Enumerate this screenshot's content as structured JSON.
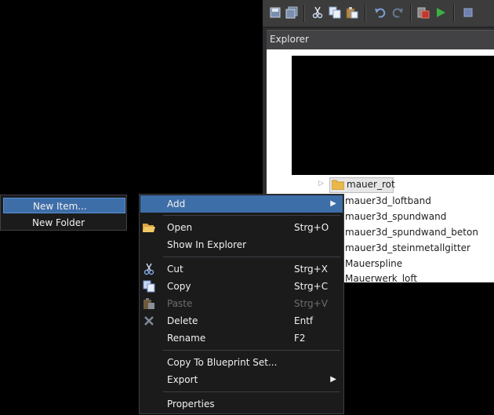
{
  "explorer": {
    "title": "Explorer",
    "tree": {
      "selected_item": "mauer_rot",
      "items": [
        "mauer3d_loftband",
        "mauer3d_spundwand",
        "mauer3d_spundwand_beton",
        "mauer3d_steinmetallgitter",
        "Mauerspline",
        "Mauerwerk_loft"
      ]
    }
  },
  "toolbar": {
    "icons": [
      "save-icon",
      "save-all-icon",
      "cut-icon",
      "copy-icon",
      "paste-icon",
      "undo-icon",
      "redo-icon",
      "build-icon",
      "play-icon",
      "stop-icon"
    ]
  },
  "submenu": {
    "items": [
      {
        "label": "New Item..."
      },
      {
        "label": "New Folder"
      }
    ]
  },
  "context_menu": {
    "add": {
      "label": "Add"
    },
    "open": {
      "label": "Open",
      "shortcut": "Strg+O"
    },
    "show_in_explorer": {
      "label": "Show In Explorer"
    },
    "cut": {
      "label": "Cut",
      "shortcut": "Strg+X"
    },
    "copy": {
      "label": "Copy",
      "shortcut": "Strg+C"
    },
    "paste": {
      "label": "Paste",
      "shortcut": "Strg+V"
    },
    "delete": {
      "label": "Delete",
      "shortcut": "Entf"
    },
    "rename": {
      "label": "Rename",
      "shortcut": "F2"
    },
    "copy_to_blueprint": {
      "label": "Copy To Blueprint Set..."
    },
    "export": {
      "label": "Export"
    },
    "properties": {
      "label": "Properties"
    }
  },
  "colors": {
    "highlight": "#3e6ea8",
    "menu_background": "#1b1b1c",
    "disabled_text": "#6d6d6d",
    "folder": "#e8b84a"
  }
}
